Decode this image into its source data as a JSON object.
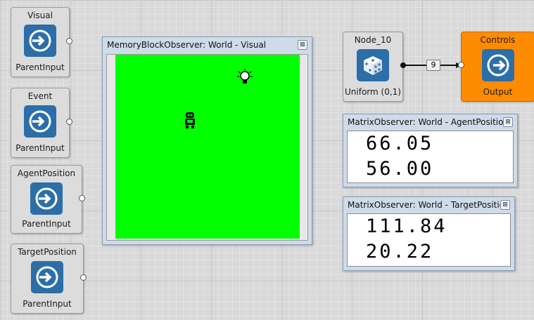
{
  "input_nodes": [
    {
      "title": "Visual",
      "subtitle": "ParentInput"
    },
    {
      "title": "Event",
      "subtitle": "ParentInput"
    },
    {
      "title": "AgentPosition",
      "subtitle": "ParentInput"
    },
    {
      "title": "TargetPosition",
      "subtitle": "ParentInput"
    }
  ],
  "visual_window": {
    "title": "MemoryBlockObserver: World - Visual",
    "background_color": "#00ff00"
  },
  "random_node": {
    "title": "Node_10",
    "subtitle": "Uniform (0,1)",
    "icon": "dice-icon"
  },
  "edge": {
    "label": "9"
  },
  "output_node": {
    "title": "Controls",
    "subtitle": "Output",
    "color": "#ff8c00",
    "icon": "output-arrow-icon"
  },
  "agent_window": {
    "title": "MatrixObserver: World - AgentPosition",
    "values": [
      "66.05",
      "56.00"
    ]
  },
  "target_window": {
    "title": "MatrixObserver: World - TargetPosition",
    "values": [
      "111.84",
      "20.22"
    ]
  },
  "close_glyph": "⊠"
}
